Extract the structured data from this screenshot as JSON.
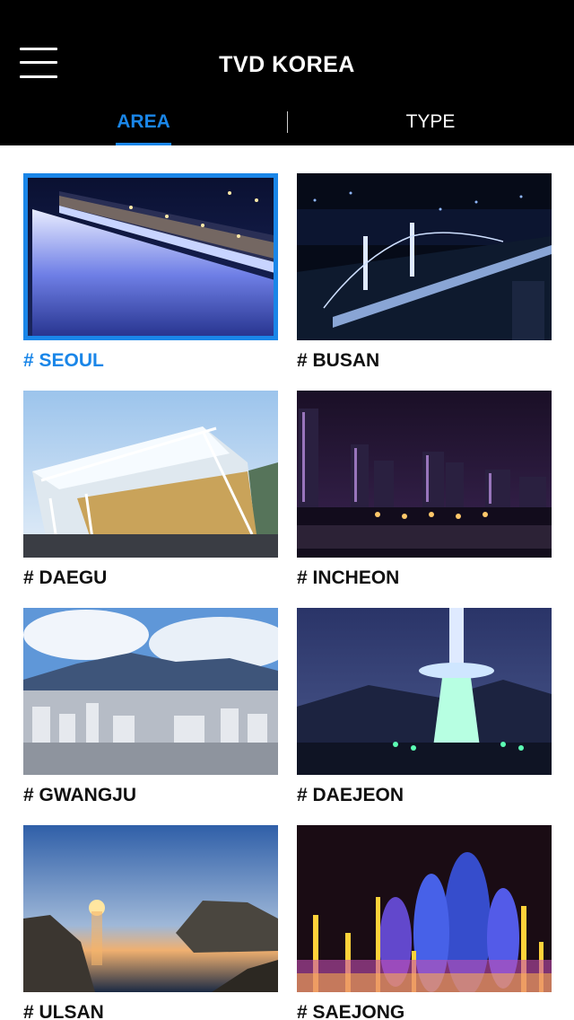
{
  "app": {
    "title": "TVD KOREA"
  },
  "tabs": [
    {
      "label": "AREA",
      "active": true
    },
    {
      "label": "TYPE",
      "active": false
    }
  ],
  "accent_color": "#1a86e8",
  "areas": [
    {
      "label": "# SEOUL",
      "selected": true,
      "scene": "bridge-fountain-night"
    },
    {
      "label": "# BUSAN",
      "selected": false,
      "scene": "suspension-bridge-night"
    },
    {
      "label": "# DAEGU",
      "selected": false,
      "scene": "stadium-roof"
    },
    {
      "label": "# INCHEON",
      "selected": false,
      "scene": "city-skyline-night"
    },
    {
      "label": "# GWANGJU",
      "selected": false,
      "scene": "city-mountain-day"
    },
    {
      "label": "# DAEJEON",
      "selected": false,
      "scene": "lit-tower-night"
    },
    {
      "label": "# ULSAN",
      "selected": false,
      "scene": "sea-sunset"
    },
    {
      "label": "# SAEJONG",
      "selected": false,
      "scene": "light-fountain"
    }
  ]
}
